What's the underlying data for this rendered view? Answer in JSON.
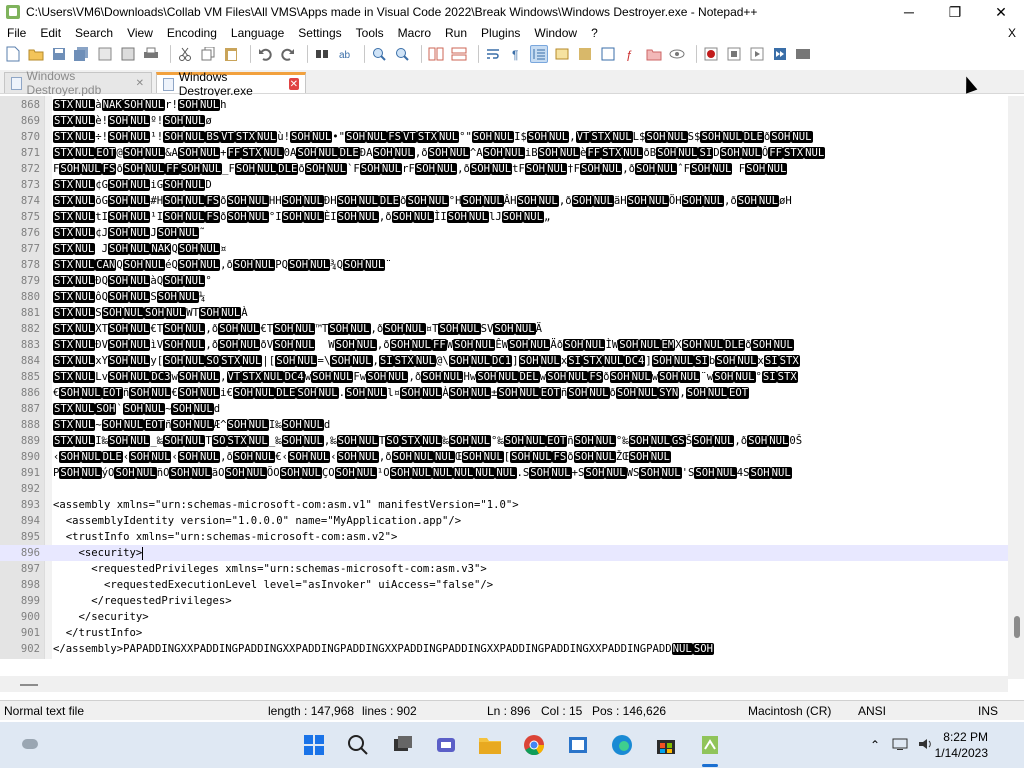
{
  "window": {
    "title": "C:\\Users\\VM6\\Downloads\\Collab VM Files\\All VMS\\Apps made in Visual Code 2022\\Break Windows\\Windows Destroyer.exe - Notepad++",
    "minimize": "─",
    "maximize": "❐",
    "close": "✕"
  },
  "menu": {
    "items": [
      "File",
      "Edit",
      "Search",
      "View",
      "Encoding",
      "Language",
      "Settings",
      "Tools",
      "Macro",
      "Run",
      "Plugins",
      "Window",
      "?"
    ],
    "close_doc": "X"
  },
  "tabs": [
    {
      "label": "Windows Destroyer.pdb",
      "close": "✕"
    },
    {
      "label": "Windows Destroyer.exe",
      "close": "✕"
    }
  ],
  "editor": {
    "lines": [
      {
        "n": "868",
        "text": "[STX][NUL]à[NAK][SOH][NUL]r![SOH][NUL]h"
      },
      {
        "n": "869",
        "text": "[STX][NUL]è![SOH][NUL]º![SOH][NUL]ø"
      },
      {
        "n": "870",
        "text": "[STX][NUL]÷![SOH][NUL]¹![SOH][NUL][BS][VT][STX][NUL]ù![SOH][NUL]•\"[SOH][NUL][FS][VT][STX][NUL]°\"[SOH][NUL]I$[SOH][NUL],[VT][STX][NUL]L$[SOH][NUL]S$[SOH][NUL][DLE]ð[SOH][NUL]"
      },
      {
        "n": "871",
        "text": "[STX][NUL][EOT]@[SOH][NUL]&A[SOH][NUL]+[FF][STX][NUL]0A[SOH][NUL][DLE]ÐA[SOH][NUL],ð[SOH][NUL]^A[SOH][NUL]iB[SOH][NUL]è[FF][STX][NUL]ðB[SOH][NUL][SI]D[SOH][NUL]Ô[FF][STX][NUL]"
      },
      {
        "n": "872",
        "text": "F[SOH][NUL][FS]ð[SOH][NUL][FF][SOH][NUL]_F[SOH][NUL][DLE]ð[SOH][NUL]`F[SOH][NUL]rF[SOH][NUL],ð[SOH][NUL]tF[SOH][NUL]†F[SOH][NUL],ð[SOH][NUL]ˆF[SOH][NUL] F[SOH][NUL]"
      },
      {
        "n": "873",
        "text": "[STX][NUL]¢G[SOH][NUL]iG[SOH][NUL]D"
      },
      {
        "n": "874",
        "text": "[STX][NUL]õG[SOH][NUL]#H[SOH][NUL][FS]ð[SOH][NUL]HH[SOH][NUL]ÐH[SOH][NUL][DLE]ð[SOH][NUL]°H[SOH][NUL]ÂH[SOH][NUL],ð[SOH][NUL]äH[SOH][NUL]ÖH[SOH][NUL],ð[SOH][NUL]øH"
      },
      {
        "n": "875",
        "text": "[STX][NUL]tI[SOH][NUL]¹I[SOH][NUL][FS]ð[SOH][NUL]°I[SOH][NUL]ÈI[SOH][NUL],ð[SOH][NUL]ÌI[SOH][NUL]lJ[SOH][NUL]„"
      },
      {
        "n": "876",
        "text": "[STX][NUL]¢J[SOH][NUL]J[SOH][NUL]˜"
      },
      {
        "n": "877",
        "text": "[STX][NUL] J[SOH][NUL][NAK]Q[SOH][NUL]¤"
      },
      {
        "n": "878",
        "text": "[STX][NUL][CAN]Q[SOH][NUL]éQ[SOH][NUL],ð[SOH][NUL]PQ[SOH][NUL]¾Q[SOH][NUL]¨"
      },
      {
        "n": "879",
        "text": "[STX][NUL]ÐQ[SOH][NUL]àQ[SOH][NUL]°"
      },
      {
        "n": "880",
        "text": "[STX][NUL]ôQ[SOH][NUL]S[SOH][NUL]¼"
      },
      {
        "n": "881",
        "text": "[STX][NUL]S[SOH][NUL][SOH][NUL]WT[SOH][NUL]À"
      },
      {
        "n": "882",
        "text": "[STX][NUL]XT[SOH][NUL]€T[SOH][NUL],ð[SOH][NUL]€T[SOH][NUL]™T[SOH][NUL],ð[SOH][NUL]¤T[SOH][NUL]SV[SOH][NUL]Ä"
      },
      {
        "n": "883",
        "text": "[STX][NUL]ÐV[SOH][NUL]ìV[SOH][NUL],ð[SOH][NUL]ðV[SOH][NUL]  W[SOH][NUL],ð[SOH][NUL][FF]W[SOH][NUL]ÊW[SOH][NUL]Äð[SOH][NUL]ÌW[SOH][NUL][EM]X[SOH][NUL][DLE]ð[SOH][NUL]"
      },
      {
        "n": "884",
        "text": "[STX][NUL]xY[SOH][NUL]y[[SOH][NUL][SO][STX][NUL]|[[SOH][NUL]=\\[SOH][NUL],[SI][STX][NUL]@\\[SOH][NUL][DC1]][SOH][NUL]x[SI][STX][NUL][DC4]][SOH][NUL][SI]b[SOH][NUL]x[SI][STX]"
      },
      {
        "n": "885",
        "text": "[STX][NUL]Lv[SOH][NUL][DC3]w[SOH][NUL],[VT][STX][NUL][DC4]w[SOH][NUL]Fw[SOH][NUL],ð[SOH][NUL]Hw[SOH][NUL][DEL]w[SOH][NUL][FS]ð[SOH][NUL]w[SOH][NUL]¨w[SOH][NUL]°[SI][STX]"
      },
      {
        "n": "886",
        "text": "€[SOH][NUL][EOT]ñ[SOH][NUL]€[SOH][NUL]i€[SOH][NUL][DLE][SOH][NUL].[SOH][NUL]l¤[SOH][NUL]À[SOH][NUL]±[SOH][NUL][EOT]ñ[SOH][NUL]ð[SOH][NUL][SYN],[SOH][NUL][EOT]"
      },
      {
        "n": "887",
        "text": "[STX][NUL][SOH]`[SOH][NUL]~[SOH][NUL]d"
      },
      {
        "n": "888",
        "text": "[STX][NUL]~[SOH][NUL][EOT]ñ[SOH][NUL]Æ^[SOH][NUL]I‰[SOH][NUL]d"
      },
      {
        "n": "889",
        "text": "[STX][NUL]I‰[SOH][NUL]_‰[SOH][NUL]T[SO][STX][NUL]_‰[SOH][NUL],‰[SOH][NUL]T[SO][STX][NUL]‰[SOH][NUL]°‰[SOH][NUL][EOT]ñ[SOH][NUL]°‰[SOH][NUL][GS]Š[SOH][NUL],ð[SOH][NUL]0Š"
      },
      {
        "n": "890",
        "text": "‹[SOH][NUL][DLE]‹[SOH][NUL]‹[SOH][NUL],ð[SOH][NUL]€‹[SOH][NUL]‹[SOH][NUL],ð[SOH][NUL][NUL]Œ[SOH][NUL][[SOH][NUL][FS]ð[SOH][NUL]ŽŒ[SOH][NUL]"
      },
      {
        "n": "891",
        "text": "P[SOH][NUL]ýO[SOH][NUL]ñO[SOH][NUL]ãO[SOH][NUL]ÕO[SOH][NUL]ÇO[SOH][NUL]¹O[SOH][NUL][NUL][NUL][NUL][NUL].S[SOH][NUL]+S[SOH][NUL]WS[SOH][NUL]'S[SOH][NUL]4S[SOH][NUL]"
      },
      {
        "n": "892",
        "text": ""
      },
      {
        "n": "893",
        "text": "<assembly xmlns=\"urn:schemas-microsoft-com:asm.v1\" manifestVersion=\"1.0\">"
      },
      {
        "n": "894",
        "text": "  <assemblyIdentity version=\"1.0.0.0\" name=\"MyApplication.app\"/>"
      },
      {
        "n": "895",
        "text": "  <trustInfo xmlns=\"urn:schemas-microsoft-com:asm.v2\">"
      },
      {
        "n": "896",
        "text": "    <security>"
      },
      {
        "n": "897",
        "text": "      <requestedPrivileges xmlns=\"urn:schemas-microsoft-com:asm.v3\">"
      },
      {
        "n": "898",
        "text": "        <requestedExecutionLevel level=\"asInvoker\" uiAccess=\"false\"/>"
      },
      {
        "n": "899",
        "text": "      </requestedPrivileges>"
      },
      {
        "n": "900",
        "text": "    </security>"
      },
      {
        "n": "901",
        "text": "  </trustInfo>"
      },
      {
        "n": "902",
        "text": "</assembly>PAPADDINGXXPADDINGPADDINGXXPADDINGPADDINGXXPADDINGPADDINGXXPADDINGPADDINGXXPADDINGPADD[NUL][SOH]"
      }
    ],
    "current_line": "896"
  },
  "status": {
    "filetype": "Normal text file",
    "length": "length : 147,968",
    "lines": "lines : 902",
    "ln": "Ln : 896",
    "col": "Col : 15",
    "pos": "Pos : 146,626",
    "eol": "Macintosh (CR)",
    "encoding": "ANSI",
    "mode": "INS"
  },
  "taskbar": {
    "time": "8:22 PM",
    "date": "1/14/2023",
    "icons": [
      "start-icon",
      "search-icon",
      "task-view-icon",
      "teams-chat-icon",
      "file-explorer-icon",
      "chrome-icon",
      "app-icon",
      "edge-icon",
      "store-icon",
      "notepad-plus-plus-icon"
    ]
  },
  "colors": {
    "accent": "#f2a13e",
    "taskbar": "#dfe8f3",
    "current_line": "#e8e8ff",
    "gutter": "#e4e4e4"
  }
}
